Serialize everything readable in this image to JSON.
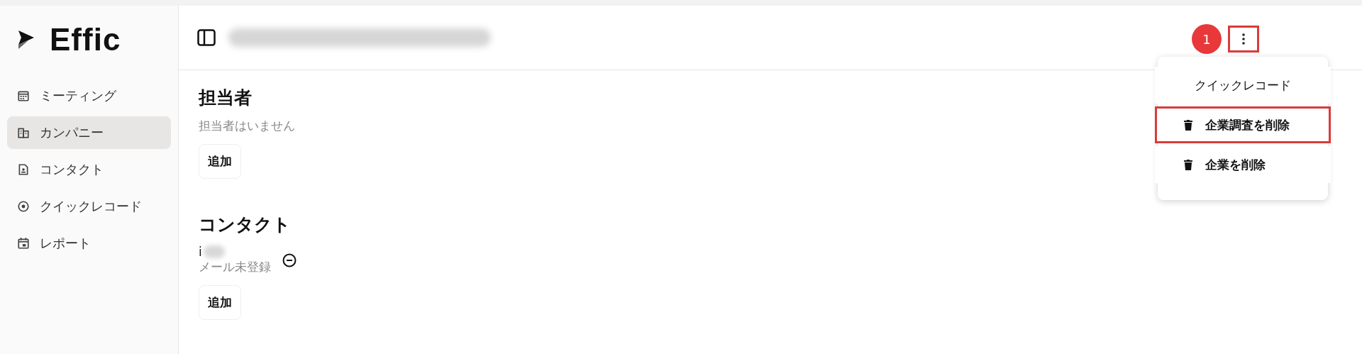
{
  "sidebar": {
    "logo": "Effic",
    "items": [
      {
        "label": "ミーティング",
        "selected": false
      },
      {
        "label": "カンパニー",
        "selected": true
      },
      {
        "label": "コンタクト",
        "selected": false
      },
      {
        "label": "クイックレコード",
        "selected": false
      },
      {
        "label": "レポート",
        "selected": false
      }
    ]
  },
  "header": {
    "annotation_badge": "1",
    "menu_button_highlighted": true
  },
  "menu": {
    "items": [
      {
        "label": "クイックレコード",
        "kind": "plain",
        "highlighted": false
      },
      {
        "label": "企業調査を削除",
        "kind": "delete",
        "highlighted": true
      },
      {
        "label": "企業を削除",
        "kind": "delete",
        "highlighted": false
      }
    ]
  },
  "assignees": {
    "heading": "担当者",
    "empty_text": "担当者はいません",
    "add_button": "追加"
  },
  "contacts": {
    "heading": "コンタクト",
    "items": [
      {
        "name": "i",
        "email_status": "メール未登録"
      }
    ],
    "add_button": "追加"
  }
}
